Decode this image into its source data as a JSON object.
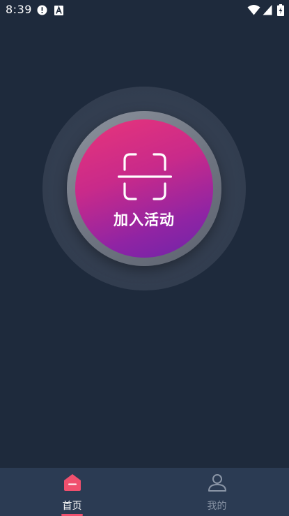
{
  "status_bar": {
    "time": "8:39",
    "icons_left": [
      "alert-circle-icon",
      "font-a-icon"
    ],
    "icons_right": [
      "wifi-icon",
      "cell-signal-icon",
      "battery-charging-icon"
    ]
  },
  "main": {
    "scan_button_label": "加入活动",
    "scan_icon": "scan-frame-icon"
  },
  "bottom_nav": {
    "items": [
      {
        "label": "首页",
        "icon": "home-icon",
        "active": true
      },
      {
        "label": "我的",
        "icon": "user-icon",
        "active": false
      }
    ],
    "active_color": "#f0506e",
    "inactive_color": "#8a95a6"
  },
  "colors": {
    "background": "#1e2a3c",
    "nav_background": "#2b3b53",
    "button_gradient_start": "#e8357a",
    "button_gradient_end": "#6e25a8"
  }
}
